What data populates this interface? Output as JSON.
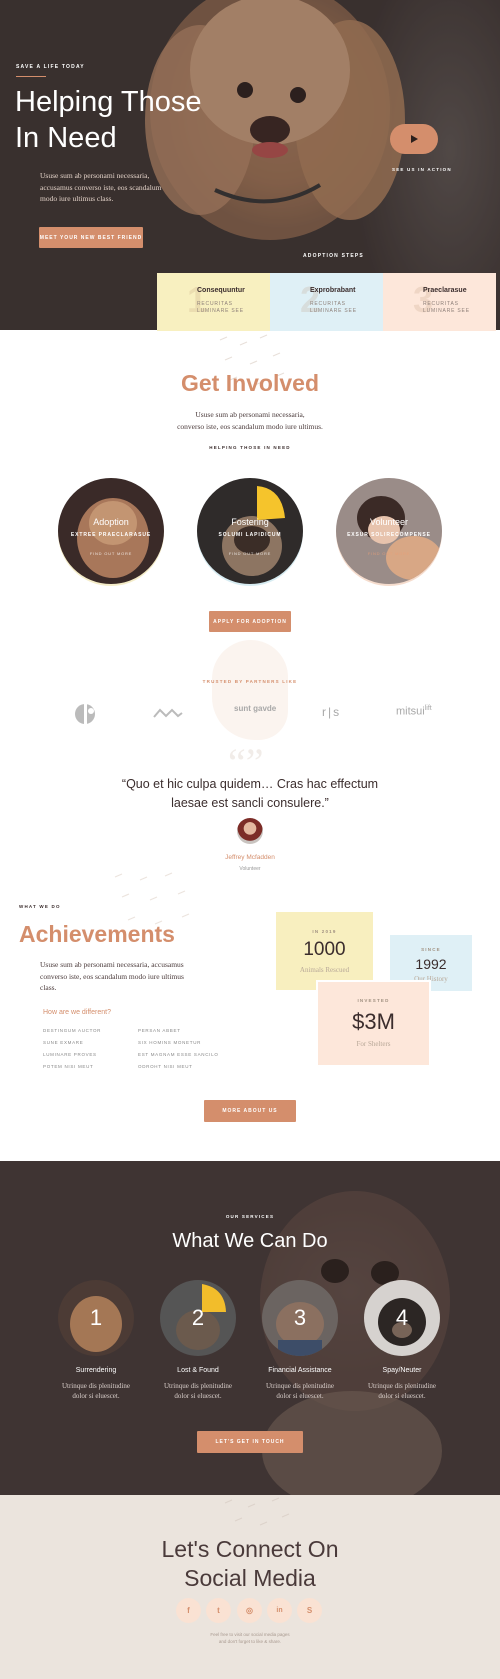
{
  "colors": {
    "accent": "#d48e6c",
    "dark": "#3d2f2e",
    "cream": "#ebe4dd"
  },
  "hero": {
    "eyebrow": "SAVE A LIFE TODAY",
    "title_line1": "Helping Those",
    "title_line2": "In Need",
    "body_line1": "Ususe sum ab personami necessaria,",
    "body_line2": "accusamus converso iste, eos scandalum",
    "body_line3": "modo iure ultimus class.",
    "cta": "MEET YOUR NEW BEST FRIEND",
    "play_icon": "play-icon",
    "play_label": "SEE US IN ACTION",
    "steps_label": "ADOPTION STEPS"
  },
  "steps": [
    {
      "num": "1",
      "title": "Consequuntur",
      "sub1": "RECURITAS",
      "sub2": "LUMINARE SEE"
    },
    {
      "num": "2",
      "title": "Exprobrabant",
      "sub1": "RECURITAS",
      "sub2": "LUMINARE SEE"
    },
    {
      "num": "3",
      "title": "Praeclarasue",
      "sub1": "RECURITAS",
      "sub2": "LUMINARE SEE"
    }
  ],
  "involved": {
    "title": "Get Involved",
    "body_line1": "Ususe sum ab personami necessaria,",
    "body_line2": "converso iste, eos scandalum modo iure ultimus.",
    "eyebrow": "HELPING THOSE IN NEED",
    "cards": [
      {
        "title": "Adoption",
        "sub": "EXTREE PRAECLARASUE",
        "more": "FIND OUT MORE"
      },
      {
        "title": "Fostering",
        "sub": "SOLUMI LAPIDICUM",
        "more": "FIND OUT MORE"
      },
      {
        "title": "Volunteer",
        "sub": "EXSUR SOLIRECOMPENSE",
        "more": "FIND OUT MORE"
      }
    ],
    "cta": "APPLY FOR ADOPTION"
  },
  "partners": {
    "label": "TRUSTED BY PARTNERS LIKE",
    "logos": [
      "circle-logo",
      "wave-logo",
      "ampersand-logo",
      "rs-logo",
      "mitsui-logo"
    ],
    "logo3_text": "sunt gavde",
    "logo4_text": "r|s",
    "logo5_text": "mitsui",
    "logo5_sup": "lift"
  },
  "testimonial": {
    "quote_line1": "“Quo et hic culpa quidem… Cras hac effectum",
    "quote_line2": "laesae est sancli consulere.”",
    "name": "Jeffrey Mcfadden",
    "role": "Volunteer"
  },
  "achievements": {
    "eyebrow": "WHAT WE DO",
    "title": "Achievements",
    "body_line1": "Ususe sum ab personami necessaria, accusamus",
    "body_line2": "converso iste, eos scandalum modo iure ultimus",
    "body_line3": "class.",
    "diff_title": "How are we different?",
    "diff_col1": [
      "DESTINGUM AUCTOR",
      "SUNE EXMARE",
      "LUMINARE PROVES",
      "POTEM NISI MEUT"
    ],
    "diff_col2": [
      "PERSAN ABBET",
      "SIX HOMINS MONETUR",
      "EST MAGNAM ESSE SANCILO",
      "ODROHT NISI MEUT"
    ],
    "stats": [
      {
        "label": "IN 2019",
        "value": "1000",
        "caption": "Animals Rescued"
      },
      {
        "label": "SINCE",
        "value": "1992",
        "caption": "Our History"
      },
      {
        "label": "INVESTED",
        "value": "$3M",
        "caption": "For Shelters"
      }
    ],
    "cta": "MORE ABOUT US"
  },
  "services": {
    "eyebrow": "OUR SERVICES",
    "title": "What We Can Do",
    "items": [
      {
        "num": "1",
        "title": "Surrendering",
        "desc1": "Utrinque dis plenitudine",
        "desc2": "dolor si eluescet."
      },
      {
        "num": "2",
        "title": "Lost & Found",
        "desc1": "Utrinque dis plenitudine",
        "desc2": "dolor si eluescet."
      },
      {
        "num": "3",
        "title": "Financial Assistance",
        "desc1": "Utrinque dis plenitudine",
        "desc2": "dolor si eluescet."
      },
      {
        "num": "4",
        "title": "Spay/Neuter",
        "desc1": "Utrinque dis plenitudine",
        "desc2": "dolor si eluescet."
      }
    ],
    "cta": "LET'S GET IN TOUCH"
  },
  "social": {
    "title_line1": "Let's Connect On",
    "title_line2": "Social Media",
    "icons": [
      {
        "name": "facebook-icon",
        "glyph": "f"
      },
      {
        "name": "twitter-icon",
        "glyph": "t"
      },
      {
        "name": "instagram-icon",
        "glyph": "◎"
      },
      {
        "name": "linkedin-icon",
        "glyph": "in"
      },
      {
        "name": "skype-icon",
        "glyph": "S"
      }
    ],
    "small_line1": "Feel free to visit our social media pages",
    "small_line2": "and don't forget to like & share."
  }
}
